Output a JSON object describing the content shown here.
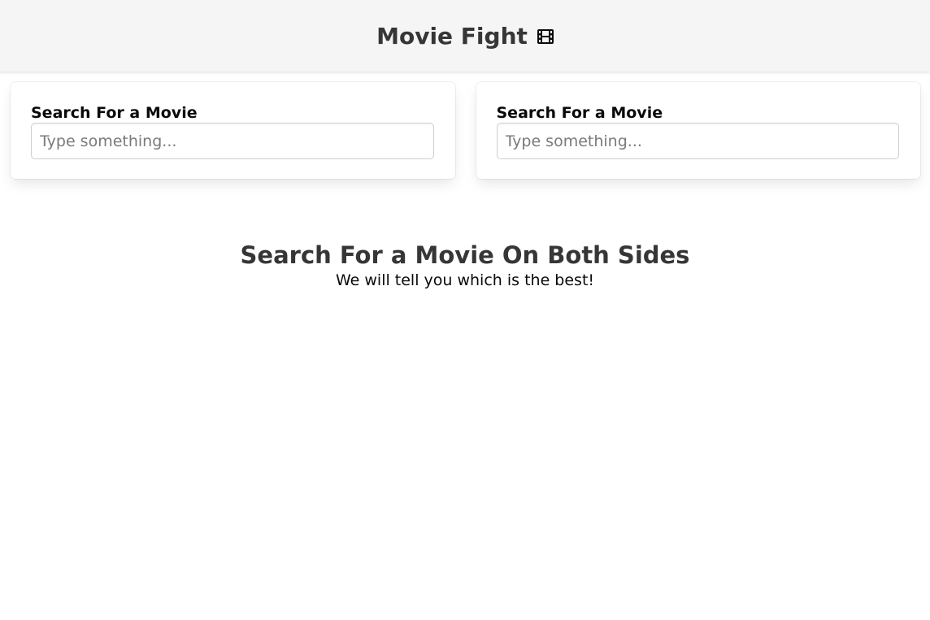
{
  "header": {
    "title": "Movie Fight",
    "icon": "film-icon"
  },
  "left_panel": {
    "label": "Search For a Movie",
    "input": {
      "value": "",
      "placeholder": "Type something..."
    }
  },
  "right_panel": {
    "label": "Search For a Movie",
    "input": {
      "value": "",
      "placeholder": "Type something..."
    }
  },
  "tutorial": {
    "title": "Search For a Movie On Both Sides",
    "subtitle": "We will tell you which is the best!"
  },
  "colors": {
    "header_bg": "#f5f5f5",
    "text": "#363636",
    "input_border": "#cfcfcf"
  }
}
